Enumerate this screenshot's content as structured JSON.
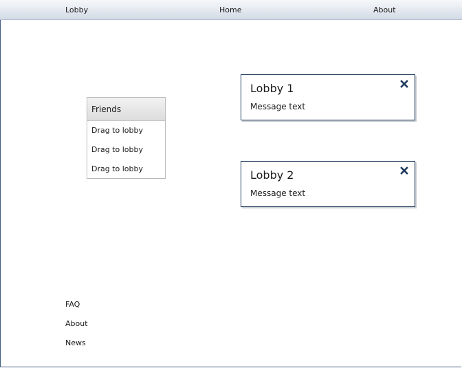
{
  "nav": {
    "lobby": "Lobby",
    "home": "Home",
    "about": "About"
  },
  "friends": {
    "title": "Friends",
    "items": [
      "Drag to lobby",
      "Drag to lobby",
      "Drag to lobby"
    ]
  },
  "lobbies": [
    {
      "title": "Lobby 1",
      "message": "Message text"
    },
    {
      "title": "Lobby 2",
      "message": "Message text"
    }
  ],
  "footer": {
    "faq": "FAQ",
    "about": "About",
    "news": "News"
  },
  "colors": {
    "border_accent": "#1f3b5c",
    "close_icon": "#1f3b5c"
  },
  "icons": {
    "close": "close-icon"
  }
}
